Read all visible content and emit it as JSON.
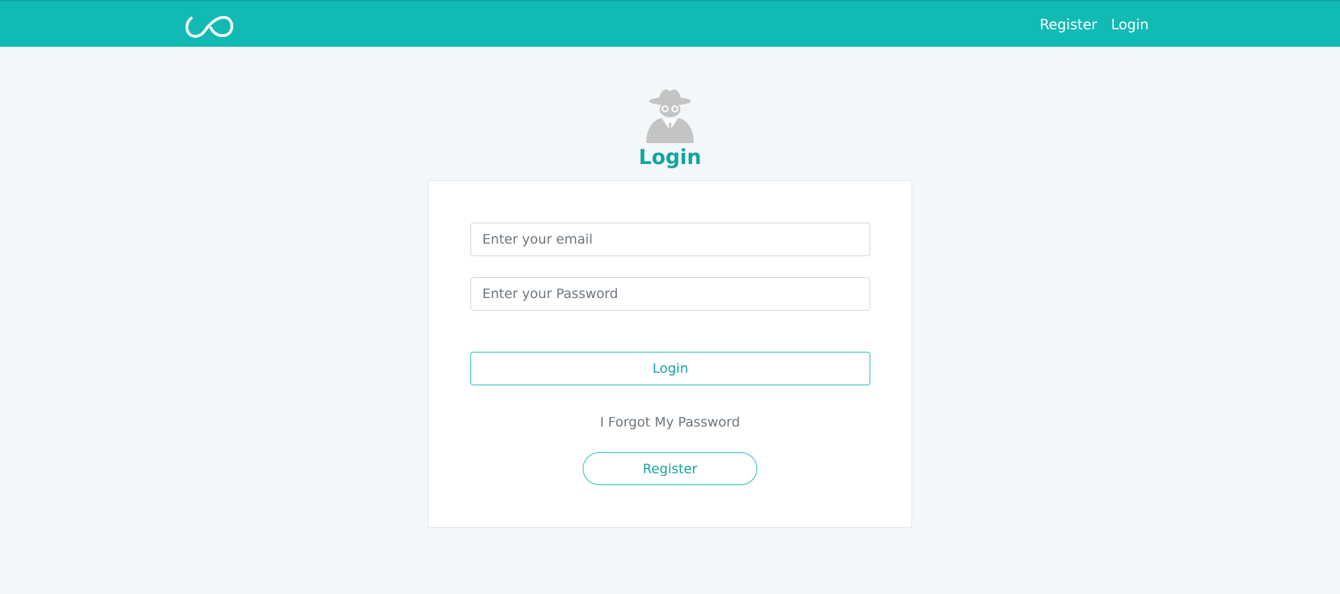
{
  "navbar": {
    "logo_icon": "infinity-logo-icon",
    "links": [
      {
        "label": "Register"
      },
      {
        "label": "Login"
      }
    ],
    "background_color": "#11bbb4"
  },
  "header": {
    "icon": "incognito-spy-icon",
    "title": "Login"
  },
  "form": {
    "email": {
      "value": "",
      "placeholder": "Enter your email"
    },
    "password": {
      "value": "",
      "placeholder": "Enter your Password"
    },
    "login_label": "Login",
    "forgot_label": "I Forgot My Password",
    "register_label": "Register"
  },
  "colors": {
    "accent": "#11bbb4",
    "title": "#12a69f",
    "page_background": "#f4f7f9",
    "icon_gray": "#c4c4c4"
  }
}
